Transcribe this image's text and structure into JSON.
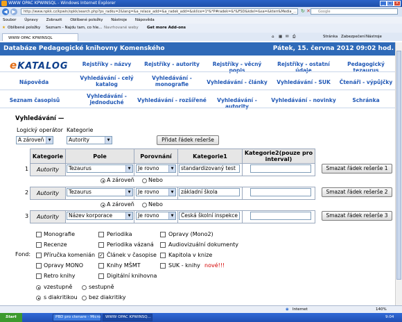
{
  "window": {
    "title": "WWW OPAC KPWINSQL - Windows Internet Explorer",
    "controls": [
      "_",
      "□",
      "×"
    ]
  },
  "browser": {
    "url": "http://www.npkk.cz/kpwin/opkk/search.php?ps_radku=2&lang=&a_relace_add=&a_radek_add=&sklice=1*&*P#radek=&*&FSD&kdel=&sa=&kterr&Media_...",
    "search_placeholder": "Google",
    "menu": [
      "Soubor",
      "Úpravy",
      "Zobrazit",
      "Oblíbené položky",
      "Nástroje",
      "Nápověda"
    ],
    "favorites": [
      "Oblíbené položky",
      "Seznam - Najdu tam, co hle...",
      "Navrhované weby",
      "Get more Add-ons"
    ],
    "tab": "WWW OPAC KPWINSQL",
    "toolbar_right": [
      "Stránka",
      "Zabezpečení",
      "Nástroje"
    ]
  },
  "header": {
    "title": "Databáze Pedagogické knihovny Komenského",
    "datetime": "Pátek, 15. června 2012 09:02 hod."
  },
  "logo": {
    "prefix": "e",
    "text": "KATALOG"
  },
  "nav": {
    "row1": [
      "Rejstříky - názvy",
      "Rejstříky - autority",
      "Rejstříky - věcný popis",
      "Rejstříky - ostatní údaje",
      "Pedagogický tezaurus"
    ],
    "row2": [
      "Nápověda",
      "Vyhledávání - celý katalog",
      "Vyhledávání - monografie",
      "Vyhledávání - články",
      "Vyhledávání - SUK",
      "Čtenáři - výpůjčky"
    ],
    "row3": [
      "Seznam časopisů",
      "Vyhledávání - jednoduché",
      "Vyhledávání - rozšířené",
      "Vyhledávání - autority",
      "Vyhledávání - novinky",
      "Schránka"
    ]
  },
  "search": {
    "heading": "Vyhledávání —",
    "logical_operator_label": "Logický operátor",
    "category_label": "Kategorie",
    "logical_operator_value": "A zároveň",
    "category_value": "Autority",
    "add_row_button": "Přidat řádek rešerše",
    "table_headers": [
      "Kategorie",
      "Pole",
      "Porovnání",
      "Kategorie1",
      "Kategorie2(pouze pro interval)"
    ],
    "rows": [
      {
        "num": "1",
        "category": "Autority",
        "field": "Tezaurus",
        "comparison": "Je rovno",
        "value1": "standardizovaný test",
        "value2": "",
        "delete": "Smazat řádek rešerše 1"
      },
      {
        "num": "2",
        "category": "Autority",
        "field": "Tezaurus",
        "comparison": "Je rovno",
        "value1": "základní škola",
        "value2": "",
        "delete": "Smazat řádek rešerše 2"
      },
      {
        "num": "3",
        "category": "Autority",
        "field": "Název korporace",
        "comparison": "Je rovno",
        "value1": "Česká školní inspekce",
        "value2": "",
        "delete": "Smazat řádek rešerše 3"
      }
    ],
    "connectors": [
      {
        "and": "A zároveň",
        "or": "Nebo"
      },
      {
        "and": "A zároveň",
        "or": "Nebo"
      }
    ],
    "fond_label": "Fond:",
    "fonds": [
      {
        "label": "Monografie",
        "checked": false
      },
      {
        "label": "Periodika",
        "checked": false
      },
      {
        "label": "Opravy (Mono2)",
        "checked": false
      },
      {
        "label": "Recenze",
        "checked": false
      },
      {
        "label": "Periodika vázaná",
        "checked": false
      },
      {
        "label": "Audiovizuální dokumenty",
        "checked": false
      },
      {
        "label": "Příručka komenián",
        "checked": false
      },
      {
        "label": "Článek v časopise",
        "checked": true
      },
      {
        "label": "Kapitola v knize",
        "checked": false
      },
      {
        "label": "Opravy MONO",
        "checked": false
      },
      {
        "label": "Knihy MŠMT",
        "checked": false
      },
      {
        "label": "SUK - knihy",
        "checked": false,
        "badge": "nové!!!"
      },
      {
        "label": "Retro knihy",
        "checked": false
      },
      {
        "label": "Digitální knihovna",
        "checked": false
      }
    ],
    "sort": {
      "asc": "vzestupně",
      "desc": "sestupně"
    },
    "diacritics": {
      "with": "s diakritikou",
      "without": "bez diakritiky"
    }
  },
  "statusbar": {
    "zone": "Internet",
    "zoom": "140%"
  },
  "taskbar": {
    "start": "Start",
    "tasks": [
      "PBD pro ctenare - Micros...",
      "WWW OPAC KPWINSQ..."
    ],
    "time": "9:04"
  },
  "colors": {
    "header_bg": "#2f6ab8",
    "nav_link": "#1f57b5",
    "new_badge": "#d40000",
    "logo_accent": "#e26d16"
  }
}
